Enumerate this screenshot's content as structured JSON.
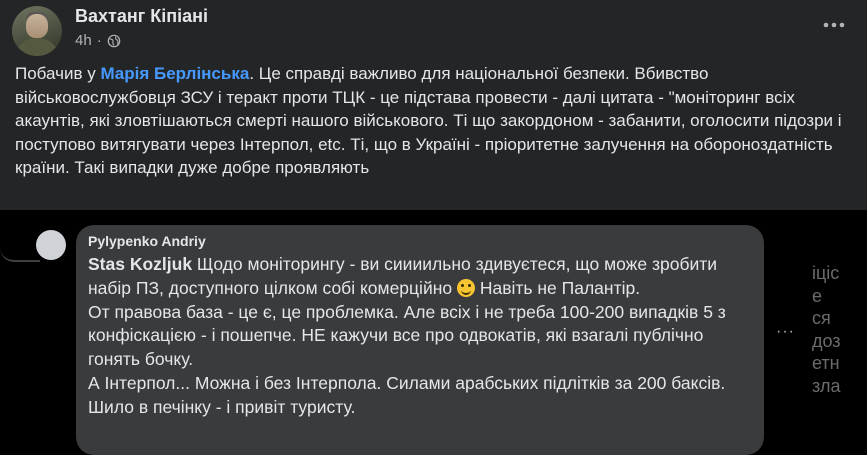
{
  "post": {
    "author": "Вахтанг Кіпіані",
    "time": "4h",
    "separator": "·",
    "visibility_icon": "globe-icon",
    "more_icon": "more-horizontal-icon",
    "text_before_mention": "Побачив у ",
    "mention": "Марія Берлінська",
    "text_after_mention": ". Це справді важливо для національної безпеки. Вбивство військовослужбовця ЗСУ і теракт проти ТЦК - це підстава провести - далі цитата - \"моніторинг всіх акаунтів, які зловтішаються смерті нашого військового. Ті що закордоном - забанити,  оголосити підозри і поступово витягувати через Інтерпол, etc. Ті, що в Україні - пріоритетне залучення на обороноздатність країни. Такі випадки дуже добре проявляють"
  },
  "comment": {
    "author": "Pylypenko Andriy",
    "tag": "Stas Kozljuk",
    "line1": " Щодо моніторингу - ви сиииильно здивуєтеся, що може зробити набір ПЗ, доступного цілком собі комерційно ",
    "emoji": "slightly-smiling-face-icon",
    "line1_end": " Навіть не Палантір.",
    "paragraph2": "От правова база - це є, це проблемка. Але всіх і не треба 100-200 випадків 5 з конфіскацією - і пошепче. НЕ кажучи все про одвокатів, які взагалі публічно гонять бочку.",
    "paragraph3": "А Інтерпол... Можна і без Інтерпола. Силами арабських підлітків за 200 баксів. Шило в печінку - і привіт туристу.",
    "more_icon": "more-horizontal-icon",
    "more_label": "···"
  },
  "cut_off_right_text": "іціс\nе\nся\nдоз\nетн\nзла",
  "colors": {
    "post_bg": "#242526",
    "comment_bg": "#3a3b3c",
    "mention": "#4599ff",
    "text": "#e4e6eb",
    "secondary": "#b0b3b8"
  }
}
